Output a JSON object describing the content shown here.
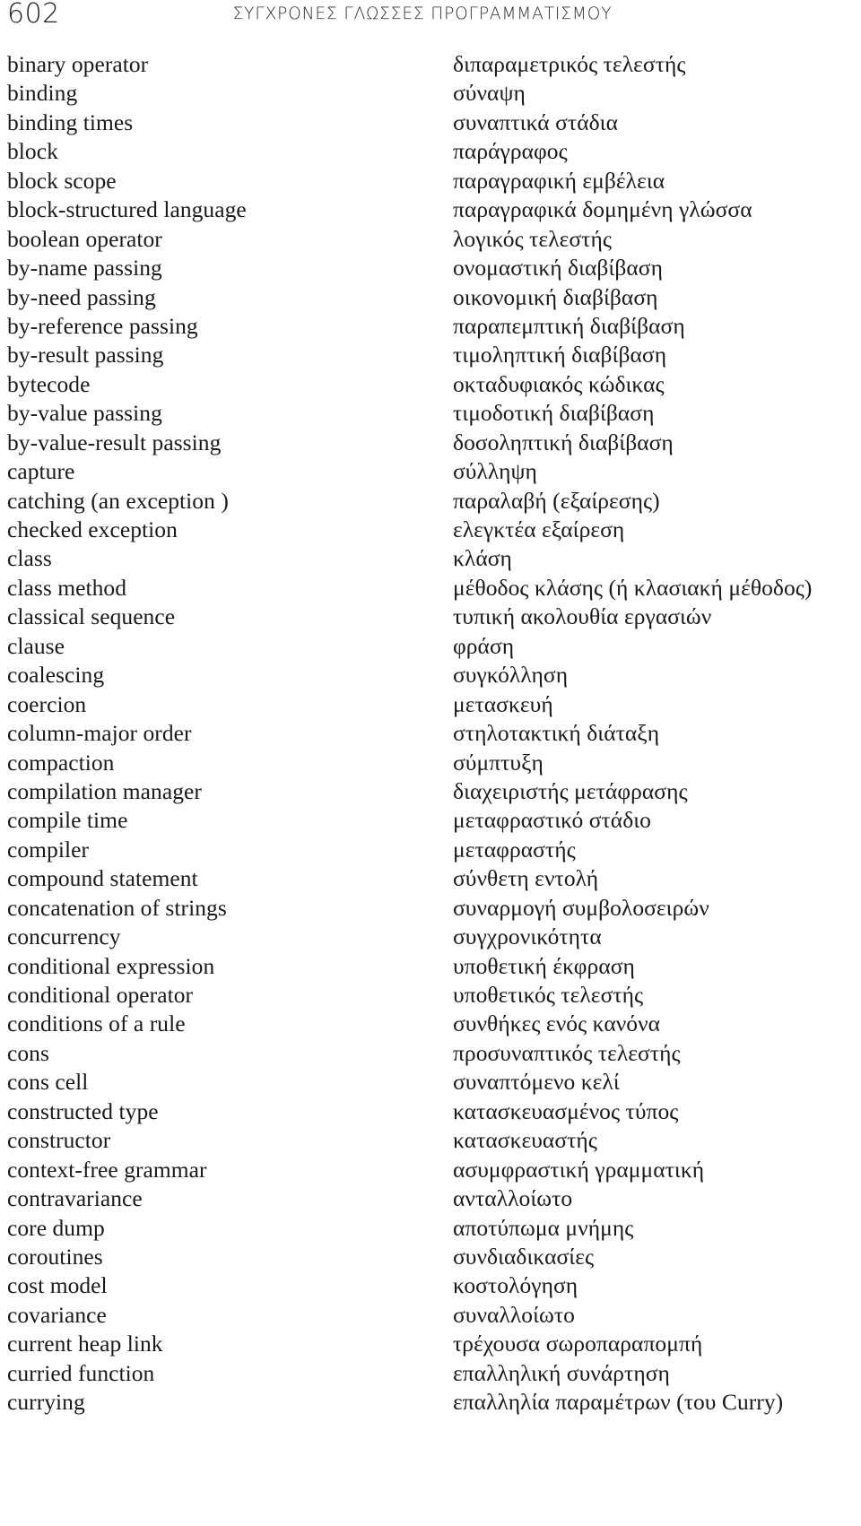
{
  "header": {
    "page_number": "602",
    "running_title": "ΣΥΓΧΡΟΝΕΣ ΓΛΩΣΣΕΣ ΠΡΟΓΡΑΜΜΑΤΙΣΜΟΥ"
  },
  "glossary": {
    "entries": [
      {
        "en": "binary operator",
        "el": "διπαραμετρικός τελεστής"
      },
      {
        "en": "binding",
        "el": "σύναψη"
      },
      {
        "en": "binding times",
        "el": "συναπτικά στάδια"
      },
      {
        "en": "block",
        "el": "παράγραφος"
      },
      {
        "en": "block scope",
        "el": "παραγραφική εμβέλεια"
      },
      {
        "en": "block-structured language",
        "el": "παραγραφικά δομημένη γλώσσα"
      },
      {
        "en": "boolean operator",
        "el": "λογικός τελεστής"
      },
      {
        "en": "by-name passing",
        "el": "ονομαστική διαβίβαση"
      },
      {
        "en": "by-need passing",
        "el": "οικονομική διαβίβαση"
      },
      {
        "en": "by-reference passing",
        "el": "παραπεμπτική διαβίβαση"
      },
      {
        "en": "by-result passing",
        "el": "τιμοληπτική διαβίβαση"
      },
      {
        "en": "bytecode",
        "el": "οκταδυφιακός κώδικας"
      },
      {
        "en": "by-value passing",
        "el": "τιμοδοτική διαβίβαση"
      },
      {
        "en": "by-value-result passing",
        "el": "δοσοληπτική διαβίβαση"
      },
      {
        "en": "capture",
        "el": "σύλληψη"
      },
      {
        "en": "catching (an exception )",
        "el": "παραλαβή (εξαίρεσης)"
      },
      {
        "en": "checked exception",
        "el": "ελεγκτέα εξαίρεση"
      },
      {
        "en": "class",
        "el": "κλάση"
      },
      {
        "en": "class method",
        "el": "μέθοδος κλάσης (ή κλασιακή μέθοδος)"
      },
      {
        "en": "classical sequence",
        "el": "τυπική ακολουθία εργασιών"
      },
      {
        "en": "clause",
        "el": "φράση"
      },
      {
        "en": "coalescing",
        "el": "συγκόλληση"
      },
      {
        "en": "coercion",
        "el": "μετασκευή"
      },
      {
        "en": "column-major order",
        "el": "στηλοτακτική διάταξη"
      },
      {
        "en": "compaction",
        "el": "σύμπτυξη"
      },
      {
        "en": "compilation manager",
        "el": "διαχειριστής μετάφρασης"
      },
      {
        "en": "compile time",
        "el": "μεταφραστικό στάδιο"
      },
      {
        "en": "compiler",
        "el": "μεταφραστής"
      },
      {
        "en": "compound statement",
        "el": "σύνθετη εντολή"
      },
      {
        "en": "concatenation of strings",
        "el": "συναρμογή συμβολοσειρών"
      },
      {
        "en": "concurrency",
        "el": "συγχρονικότητα"
      },
      {
        "en": "conditional expression",
        "el": "υποθετική έκφραση"
      },
      {
        "en": "conditional operator",
        "el": "υποθετικός τελεστής"
      },
      {
        "en": "conditions of a rule",
        "el": "συνθήκες ενός κανόνα"
      },
      {
        "en": "cons",
        "el": "προσυναπτικός τελεστής"
      },
      {
        "en": "cons cell",
        "el": "συναπτόμενο κελί"
      },
      {
        "en": "constructed type",
        "el": "κατασκευασμένος τύπος"
      },
      {
        "en": "constructor",
        "el": "κατασκευαστής"
      },
      {
        "en": "context-free grammar",
        "el": "ασυμφραστική γραμματική"
      },
      {
        "en": "contravariance",
        "el": "ανταλλοίωτο"
      },
      {
        "en": "core dump",
        "el": "αποτύπωμα μνήμης"
      },
      {
        "en": "coroutines",
        "el": "συνδιαδικασίες"
      },
      {
        "en": "cost model",
        "el": "κοστολόγηση"
      },
      {
        "en": "covariance",
        "el": "συναλλοίωτο"
      },
      {
        "en": "current heap link",
        "el": "τρέχουσα σωροπαραπομπή"
      },
      {
        "en": "curried function",
        "el": "επαλληλική συνάρτηση"
      },
      {
        "en": "currying",
        "el": "επαλληλία παραμέτρων (του Curry)"
      }
    ]
  }
}
